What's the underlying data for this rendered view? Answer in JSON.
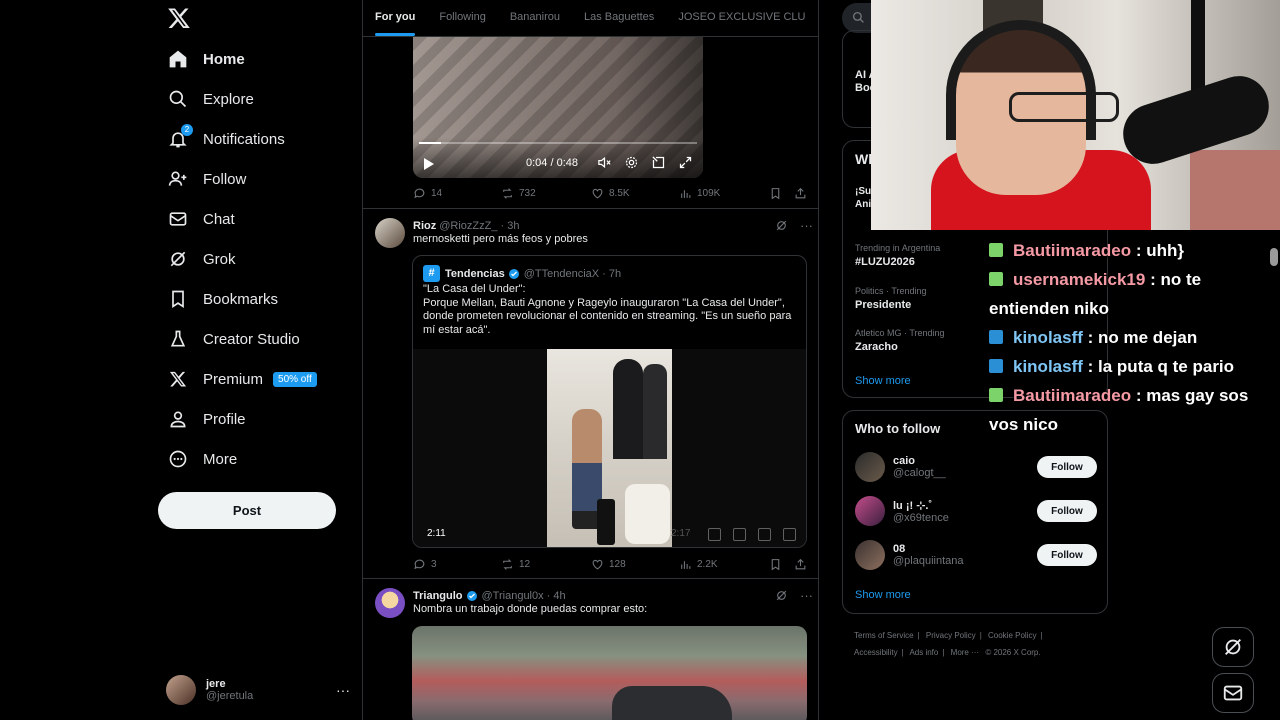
{
  "sidebar": {
    "nav": [
      {
        "label": "Home",
        "icon": "home-icon"
      },
      {
        "label": "Explore",
        "icon": "search-icon"
      },
      {
        "label": "Notifications",
        "icon": "bell-icon",
        "badge": "2"
      },
      {
        "label": "Follow",
        "icon": "person-plus-icon"
      },
      {
        "label": "Chat",
        "icon": "envelope-icon"
      },
      {
        "label": "Grok",
        "icon": "grok-icon"
      },
      {
        "label": "Bookmarks",
        "icon": "bookmark-icon"
      },
      {
        "label": "Creator Studio",
        "icon": "flask-icon"
      },
      {
        "label": "Premium",
        "icon": "x-logo-icon",
        "pill": "50% off"
      },
      {
        "label": "Profile",
        "icon": "person-icon"
      },
      {
        "label": "More",
        "icon": "more-circle-icon"
      }
    ],
    "post_label": "Post",
    "account": {
      "name": "jere",
      "handle": "@jeretula"
    }
  },
  "timeline": {
    "tabs": [
      "For you",
      "Following",
      "Bananirou",
      "Las Baguettes",
      "JOSEO EXCLUSIVE CLU"
    ],
    "post1": {
      "video_time": "0:04 / 0:48",
      "actions": {
        "replies": "14",
        "reposts": "732",
        "likes": "8.5K",
        "views": "109K"
      }
    },
    "post2": {
      "name": "Rioz",
      "meta": "@RiozZzZ_ · 3h",
      "text": "mernosketti pero más feos y pobres",
      "quote": {
        "name": "Tendencias",
        "meta": "@TTendenciaX · 7h",
        "text": "\"La Casa del Under\":\nPorque Mellan, Bauti Agnone y Rageylo inauguraron \"La Casa del Under\", donde prometen revolucionar el contenido en streaming. \"Es un sueño para mí estar acá\".",
        "video_duration": "2:11",
        "video_duration_ghost": "2:17"
      },
      "actions": {
        "replies": "3",
        "reposts": "12",
        "likes": "128",
        "views": "2.2K"
      }
    },
    "post3": {
      "name": "Triangulo",
      "meta": "@Triangul0x · 4h",
      "text": "Nombra un trabajo donde puedas comprar esto:"
    }
  },
  "right": {
    "card1_frag": "AI A\nBoo",
    "card2_head": "Wh",
    "card2_frag": "¡Su\nAni",
    "trends": [
      {
        "context": "Trending in Argentina",
        "title": "#LUZU2026"
      },
      {
        "context": "Politics · Trending",
        "title": "Presidente"
      },
      {
        "context": "Atletico MG · Trending",
        "title": "Zaracho"
      }
    ],
    "show_more": "Show more",
    "who_to_follow": {
      "title": "Who to follow",
      "people": [
        {
          "name": "caio",
          "handle": "@calogt__"
        },
        {
          "name": "lu ¡! ⊹.˚",
          "handle": "@x69tence"
        },
        {
          "name": "08",
          "handle": "@plaquiintana"
        }
      ],
      "follow_label": "Follow",
      "show_more": "Show more"
    },
    "footer": [
      "Terms of Service",
      "|",
      "Privacy Policy",
      "|",
      "Cookie Policy",
      "|",
      "Accessibility",
      "|",
      "Ads info",
      "|",
      "More ···",
      "© 2026 X Corp."
    ]
  },
  "chat": [
    {
      "user": "Bautiimaradeo",
      "msg": ": uhh}",
      "color": "#f59aa4",
      "badge": "#7bd36a"
    },
    {
      "user": "usernamekick19",
      "msg": ": no te entienden niko",
      "color": "#f59aa4",
      "badge": "#7bd36a"
    },
    {
      "user": "kinolasff",
      "msg": ": no me dejan",
      "color": "#7fc6f5",
      "badge": "#2b8fd6"
    },
    {
      "user": "kinolasff",
      "msg": ": la puta q te pario",
      "color": "#7fc6f5",
      "badge": "#2b8fd6"
    },
    {
      "user": "Bautiimaradeo",
      "msg": ": mas gay sos vos nico",
      "color": "#f59aa4",
      "badge": "#7bd36a"
    }
  ],
  "colors": {
    "accent": "#1d9bf0",
    "bg": "#000000",
    "muted": "#71767b"
  }
}
